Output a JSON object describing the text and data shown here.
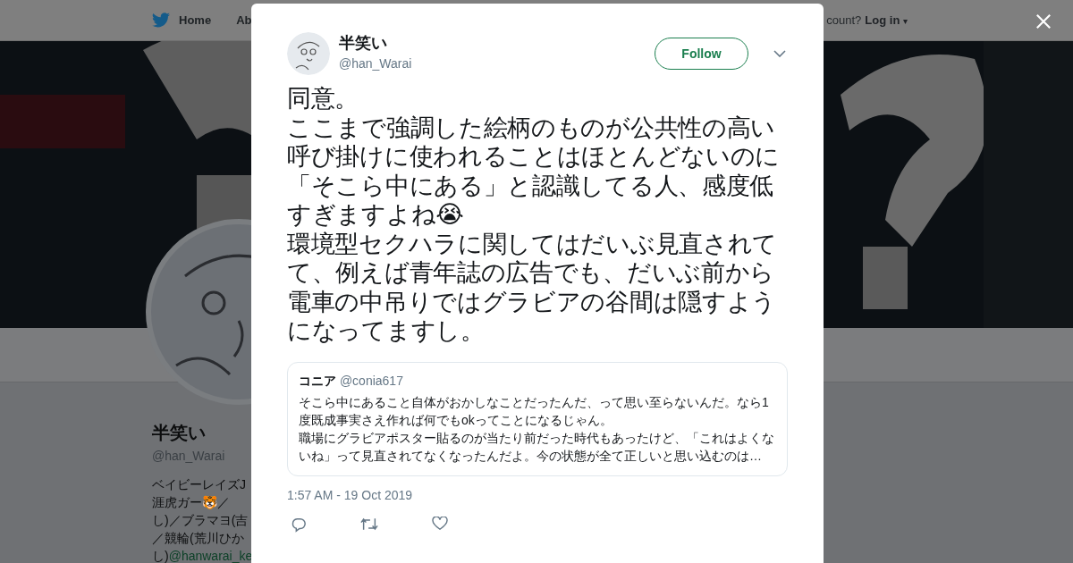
{
  "background_page": {
    "nav": {
      "items": [
        "Home",
        "Ab"
      ],
      "login_prompt": "count?",
      "login": "Log in",
      "caret": "▾"
    },
    "profile": {
      "name": "半笑い",
      "handle": "@han_Warai",
      "bio_lines": [
        "ベイビーレイズJ",
        "涯虎ガー🐯／",
        "し)／ブラマヨ(吉",
        "／競輪(荒川ひか"
      ],
      "bio_last": "し)",
      "bio_link": "@hanwarai_ke"
    }
  },
  "tweet": {
    "author": {
      "name": "半笑い",
      "handle": "@han_Warai"
    },
    "follow_button": "Follow",
    "paragraphs": [
      "同意。",
      "ここまで強調した絵柄のものが公共性の高い呼び掛けに使われることはほとんどないのに「そこら中にある」と認識してる人、感度低すぎますよね😭",
      "環境型セクハラに関してはだいぶ見直されてて、例えば青年誌の広告でも、だいぶ前から電車の中吊りではグラビアの谷間は隠すようになってますし。"
    ],
    "quoted": {
      "name": "コニア",
      "handle": "@conia617",
      "paragraphs": [
        "そこら中にあること自体がおかしなことだったんだ、って思い至らないんだ。なら1度既成事実さえ作れば何でもokってことになるじゃん。",
        "職場にグラビアポスター貼るのが当たり前だった時代もあったけど、「これはよくないね」って見直されてなくなったんだよ。今の状態が全て正しいと思い込むのは…"
      ]
    },
    "timestamp": "1:57 AM - 19 Oct 2019"
  }
}
